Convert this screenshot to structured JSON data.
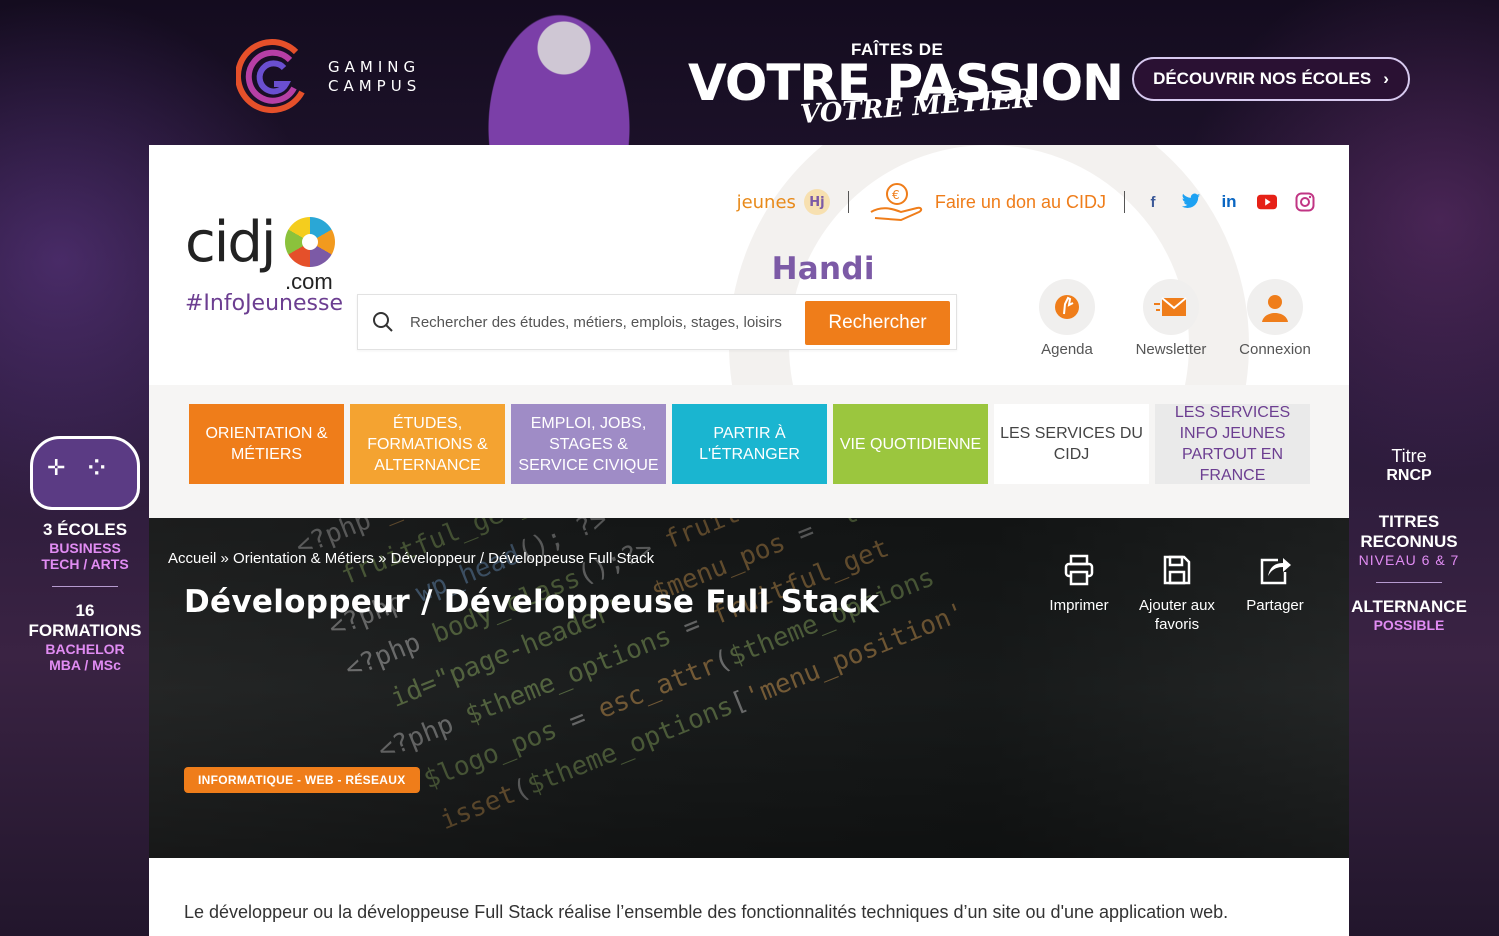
{
  "ad": {
    "brand_line1": "GAMING",
    "brand_line2": "CAMPUS",
    "headline_small": "FAÎTES DE",
    "headline_big": "VOTRE PASSION",
    "headline_script": "VOTRE MÉTIER",
    "cta": "DÉCOUVRIR NOS ÉCOLES",
    "left": {
      "schools": "3 ÉCOLES",
      "schools_sub1": "BUSINESS",
      "schools_sub2": "TECH / ARTS",
      "formations_num": "16",
      "formations": "FORMATIONS",
      "formations_sub1": "BACHELOR",
      "formations_sub2": "MBA / MSc"
    },
    "right": {
      "laurel_line1": "Titre",
      "laurel_line2": "RNCP",
      "titres1": "TITRES",
      "titres2": "RECONNUS",
      "niveau": "NIVEAU 6 & 7",
      "alternance": "ALTERNANCE",
      "possible": "POSSIBLE"
    }
  },
  "header": {
    "handi_part1": "Handi",
    "handi_part2": "jeunes",
    "handi_badge": "Hj",
    "don_label": "Faire un don au CIDJ",
    "logo_main": "cidj",
    "logo_com": ".com",
    "logo_tag": "#InfoJeunesse",
    "search_placeholder": "Rechercher des études, métiers, emplois, stages, loisirs",
    "search_button": "Rechercher",
    "user_items": [
      {
        "label": "Agenda",
        "icon": "hand-wave-icon"
      },
      {
        "label": "Newsletter",
        "icon": "envelope-icon"
      },
      {
        "label": "Connexion",
        "icon": "user-icon"
      }
    ]
  },
  "nav": [
    {
      "label": "ORIENTATION & MÉTIERS"
    },
    {
      "label": "ÉTUDES, FORMATIONS & ALTERNANCE"
    },
    {
      "label": "EMPLOI, JOBS, STAGES & SERVICE CIVIQUE"
    },
    {
      "label": "PARTIR À L'ÉTRANGER"
    },
    {
      "label": "VIE QUOTIDIENNE"
    },
    {
      "label": "LES SERVICES DU CIDJ"
    },
    {
      "label": "LES SERVICES INFO JEUNES PARTOUT EN FRANCE"
    }
  ],
  "colors": {
    "orange": "#ef7d1a",
    "purple": "#6c3e91"
  },
  "page": {
    "breadcrumb": [
      "Accueil",
      "Orientation & Métiers",
      "Développeur / Développeuse Full Stack"
    ],
    "breadcrumb_sep": " » ",
    "title": "Développeur / Développeuse Full Stack",
    "actions": [
      {
        "label": "Imprimer",
        "icon": "printer-icon"
      },
      {
        "label": "Ajouter aux favoris",
        "icon": "save-icon"
      },
      {
        "label": "Partager",
        "icon": "share-icon"
      }
    ],
    "category_tag": "INFORMATIQUE - WEB - RÉSEAUX",
    "intro": "Le développeur ou la développeuse Full Stack réalise l’ensemble des fonctionnalités techniques d’un site ou d'une application web."
  }
}
